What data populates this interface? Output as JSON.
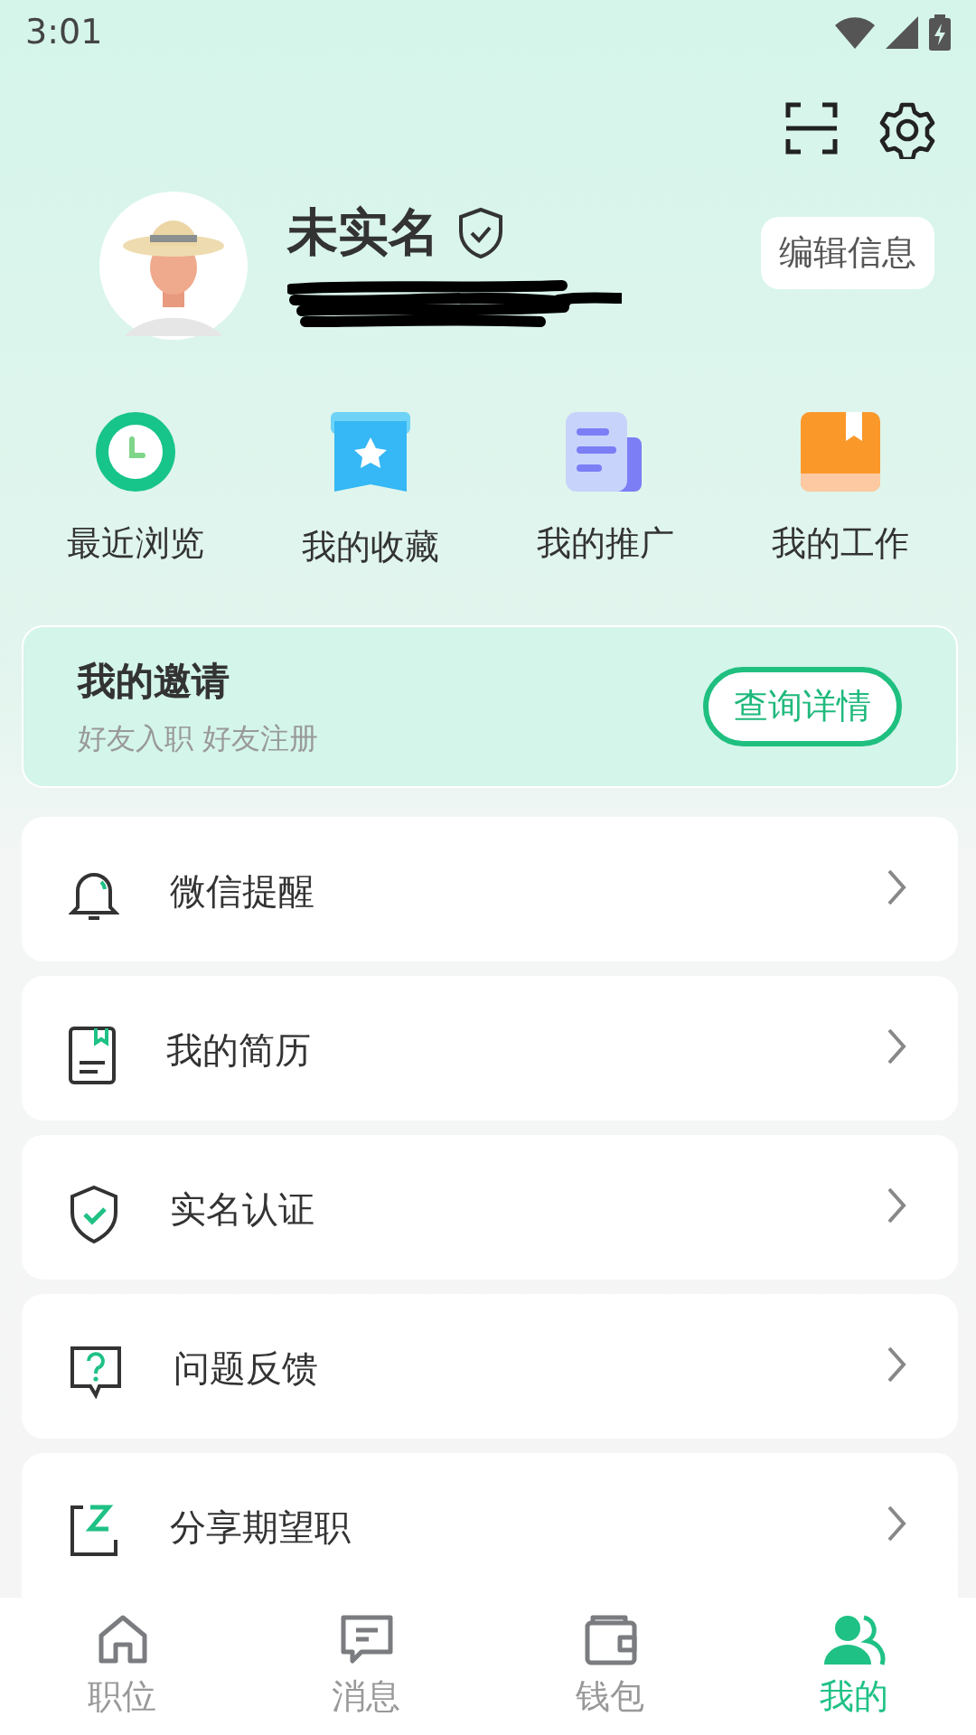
{
  "status_bar": {
    "time": "3:01"
  },
  "profile": {
    "name": "未实名",
    "verified": false,
    "edit_button": "编辑信息"
  },
  "shortcuts": [
    {
      "kind": "clock",
      "label": "最近浏览"
    },
    {
      "kind": "star",
      "label": "我的收藏"
    },
    {
      "kind": "doc",
      "label": "我的推广"
    },
    {
      "kind": "book",
      "label": "我的工作"
    }
  ],
  "invite_card": {
    "title": "我的邀请",
    "subtitle": "好友入职 好友注册",
    "button": "查询详情"
  },
  "menu": [
    {
      "kind": "bell",
      "label": "微信提醒"
    },
    {
      "kind": "resume",
      "label": "我的简历"
    },
    {
      "kind": "shield",
      "label": "实名认证"
    },
    {
      "kind": "question",
      "label": "问题反馈"
    },
    {
      "kind": "share",
      "label": "分享期望职"
    }
  ],
  "tabs": [
    {
      "kind": "home",
      "label": "职位",
      "selected": false
    },
    {
      "kind": "message",
      "label": "消息",
      "selected": false
    },
    {
      "kind": "wallet",
      "label": "钱包",
      "selected": false
    },
    {
      "kind": "user",
      "label": "我的",
      "selected": true
    }
  ]
}
